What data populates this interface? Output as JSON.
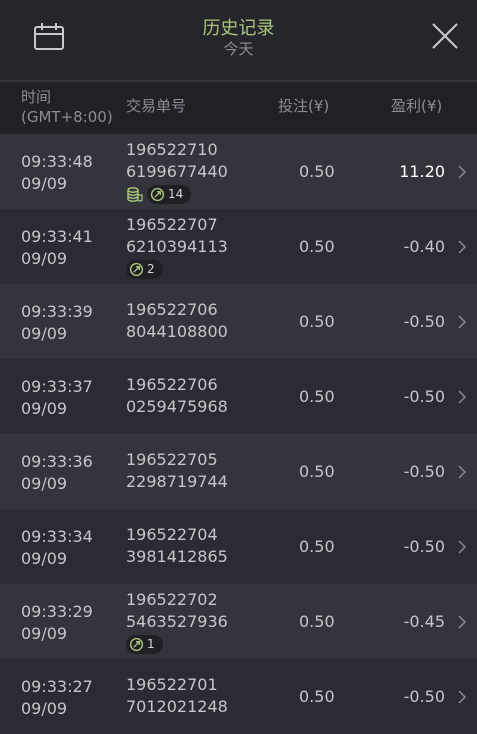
{
  "header": {
    "title": "历史记录",
    "subtitle": "今天",
    "calendar_icon": "calendar-icon",
    "close_icon": "close-icon"
  },
  "columns": {
    "time": "时间",
    "timezone": "(GMT+8:00)",
    "order": "交易单号",
    "bet": "投注(¥)",
    "profit": "盈利(¥)"
  },
  "rows": [
    {
      "time": "09:33:48",
      "date": "09/09",
      "order_a": "196522710",
      "order_b": "6199677440",
      "bet": "0.50",
      "profit": "11.20",
      "coin": true,
      "count": "14"
    },
    {
      "time": "09:33:41",
      "date": "09/09",
      "order_a": "196522707",
      "order_b": "6210394113",
      "bet": "0.50",
      "profit": "-0.40",
      "coin": false,
      "count": "2"
    },
    {
      "time": "09:33:39",
      "date": "09/09",
      "order_a": "196522706",
      "order_b": "8044108800",
      "bet": "0.50",
      "profit": "-0.50"
    },
    {
      "time": "09:33:37",
      "date": "09/09",
      "order_a": "196522706",
      "order_b": "0259475968",
      "bet": "0.50",
      "profit": "-0.50"
    },
    {
      "time": "09:33:36",
      "date": "09/09",
      "order_a": "196522705",
      "order_b": "2298719744",
      "bet": "0.50",
      "profit": "-0.50"
    },
    {
      "time": "09:33:34",
      "date": "09/09",
      "order_a": "196522704",
      "order_b": "3981412865",
      "bet": "0.50",
      "profit": "-0.50"
    },
    {
      "time": "09:33:29",
      "date": "09/09",
      "order_a": "196522702",
      "order_b": "5463527936",
      "bet": "0.50",
      "profit": "-0.45",
      "coin": false,
      "count": "1"
    },
    {
      "time": "09:33:27",
      "date": "09/09",
      "order_a": "196522701",
      "order_b": "7012021248",
      "bet": "0.50",
      "profit": "-0.50"
    }
  ],
  "colors": {
    "title": "#a8c77a",
    "background": "#2b2b33",
    "row_alt": "#34343c",
    "win": "#ffffff"
  }
}
